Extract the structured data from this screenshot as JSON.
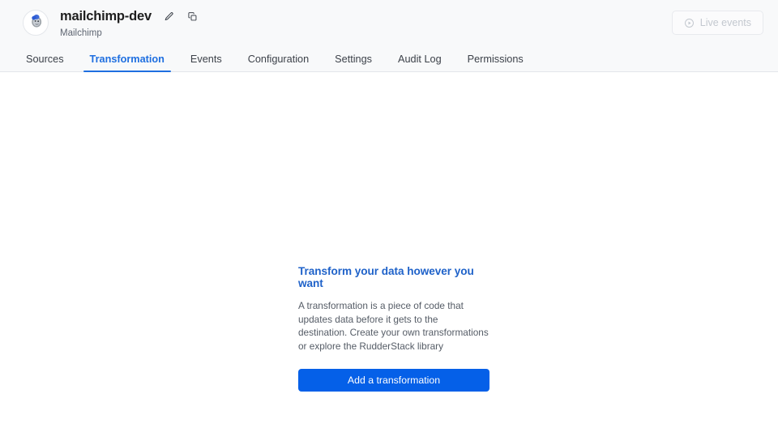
{
  "header": {
    "avatar_icon": "mailchimp-logo-icon",
    "title": "mailchimp-dev",
    "subtitle": "Mailchimp",
    "edit_icon": "pencil-icon",
    "copy_icon": "copy-icon",
    "live_events": {
      "label": "Live events",
      "icon": "play-circle-icon",
      "disabled": true
    }
  },
  "tabs": [
    {
      "label": "Sources",
      "active": false
    },
    {
      "label": "Transformation",
      "active": true
    },
    {
      "label": "Events",
      "active": false
    },
    {
      "label": "Configuration",
      "active": false
    },
    {
      "label": "Settings",
      "active": false
    },
    {
      "label": "Audit Log",
      "active": false
    },
    {
      "label": "Permissions",
      "active": false
    }
  ],
  "empty_state": {
    "heading": "Transform your data however you want",
    "description": "A transformation is a piece of code that updates data before it gets to the destination. Create your own transformations or explore the RudderStack library",
    "button_label": "Add a transformation"
  },
  "colors": {
    "accent_blue": "#1f6fe0",
    "heading_blue": "#1f62c9",
    "button_blue": "#0560e8",
    "header_bg": "#f8f9fa",
    "border": "#e3e6ea",
    "text_dark": "#1e1e1e",
    "text_muted": "#5f6672",
    "disabled_text": "#c3c8cf"
  }
}
